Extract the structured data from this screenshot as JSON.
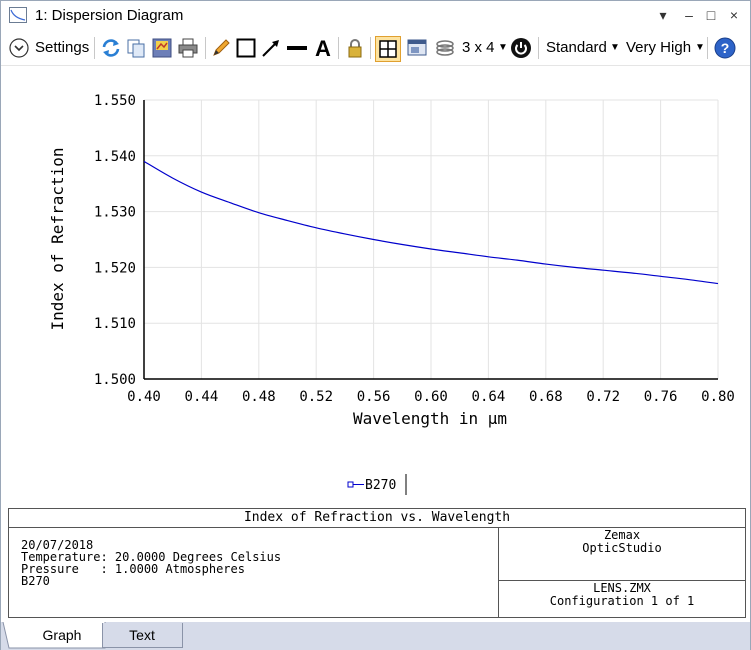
{
  "window": {
    "title": "1: Dispersion Diagram",
    "controls": [
      "▾",
      "‒",
      "□",
      "×"
    ]
  },
  "toolbar": {
    "settings_label": "Settings",
    "layout_label": "3 x 4",
    "quality_label": "Standard",
    "resolution_label": "Very High"
  },
  "chart_data": {
    "type": "line",
    "ylabel": "Index of Refraction",
    "xlabel": "Wavelength in µm",
    "xlim": [
      0.4,
      0.8
    ],
    "ylim": [
      1.5,
      1.55
    ],
    "xticks": [
      "0.40",
      "0.44",
      "0.48",
      "0.52",
      "0.56",
      "0.60",
      "0.64",
      "0.68",
      "0.72",
      "0.76",
      "0.80"
    ],
    "yticks": [
      "1.500",
      "1.510",
      "1.520",
      "1.530",
      "1.540",
      "1.550"
    ],
    "grid": true,
    "legend_position": "bottom-center",
    "series": [
      {
        "name": "B270",
        "color": "#0000cc",
        "x": [
          0.4,
          0.42,
          0.44,
          0.46,
          0.48,
          0.5,
          0.52,
          0.54,
          0.56,
          0.58,
          0.6,
          0.62,
          0.64,
          0.66,
          0.68,
          0.7,
          0.72,
          0.74,
          0.76,
          0.78,
          0.8
        ],
        "y": [
          1.539,
          1.536,
          1.5335,
          1.5316,
          1.5298,
          1.5284,
          1.5271,
          1.526,
          1.525,
          1.5241,
          1.5233,
          1.5226,
          1.5219,
          1.5213,
          1.5206,
          1.52,
          1.5195,
          1.519,
          1.5184,
          1.5178,
          1.5171
        ]
      }
    ]
  },
  "footer": {
    "title": "Index of Refraction vs. Wavelength",
    "date": "20/07/2018",
    "temperature": "Temperature: 20.0000 Degrees Celsius",
    "pressure": "Pressure   : 1.0000 Atmospheres",
    "material": "B270",
    "brand_line1": "Zemax",
    "brand_line2": "OpticStudio",
    "file": "LENS.ZMX",
    "configuration": "Configuration 1 of 1"
  },
  "tabs": {
    "graph": "Graph",
    "text": "Text"
  }
}
